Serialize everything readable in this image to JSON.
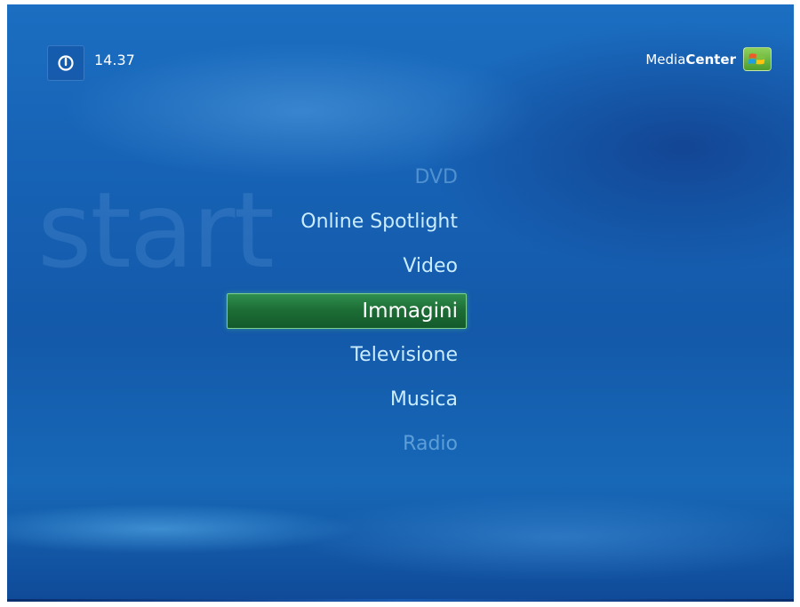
{
  "background_watermark": "start",
  "header": {
    "clock": "14.37",
    "brand_prefix": "Media",
    "brand_suffix": "Center"
  },
  "icons": {
    "power": "power-icon",
    "logo": "windows-flag-logo"
  },
  "menu": {
    "items": [
      {
        "label": "DVD",
        "state": "faded"
      },
      {
        "label": "Online Spotlight",
        "state": "normal"
      },
      {
        "label": "Video",
        "state": "normal"
      },
      {
        "label": "Immagini",
        "state": "selected"
      },
      {
        "label": "Televisione",
        "state": "normal"
      },
      {
        "label": "Musica",
        "state": "normal"
      },
      {
        "label": "Radio",
        "state": "faded"
      }
    ]
  },
  "colors": {
    "background": "#1763b6",
    "selection": "#1d6e36",
    "menu_text": "#c9ecff"
  }
}
